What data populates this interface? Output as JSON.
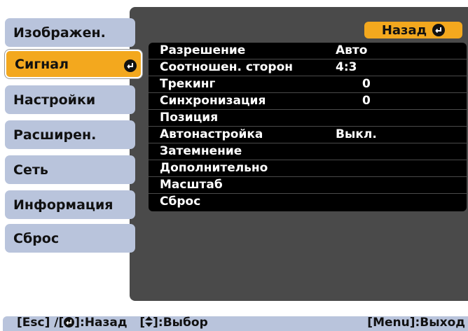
{
  "sidebar": {
    "items": [
      {
        "label": "Изображен."
      },
      {
        "label": "Сигнал"
      },
      {
        "label": "Настройки"
      },
      {
        "label": "Расширен."
      },
      {
        "label": "Сеть"
      },
      {
        "label": "Информация"
      },
      {
        "label": "Сброс"
      }
    ],
    "active_index": 1,
    "active_icon": "enter-icon"
  },
  "back_button": {
    "label": "Назад",
    "icon": "enter-icon"
  },
  "settings": [
    {
      "label": "Разрешение",
      "value": "Авто"
    },
    {
      "label": "Соотношен. сторон",
      "value": "4:3"
    },
    {
      "label": "Трекинг",
      "value": "0"
    },
    {
      "label": "Синхронизация",
      "value": "0"
    },
    {
      "label": "Позиция",
      "value": ""
    },
    {
      "label": "Автонастройка",
      "value": "Выкл."
    },
    {
      "label": "Затемнение",
      "value": ""
    },
    {
      "label": "Дополнительно",
      "value": ""
    },
    {
      "label": "Масштаб",
      "value": ""
    },
    {
      "label": "Сброс",
      "value": ""
    }
  ],
  "footer": {
    "esc_key": "[Esc] /[",
    "back_hint": "]:Назад",
    "select_key_open": "[",
    "select_hint": "]:Выбор",
    "exit_hint": "[Menu]:Выход"
  },
  "colors": {
    "accent": "#f3a81e",
    "tab": "#b9c4dc",
    "panel": "#4a4a4a",
    "list_bg": "#000000"
  }
}
